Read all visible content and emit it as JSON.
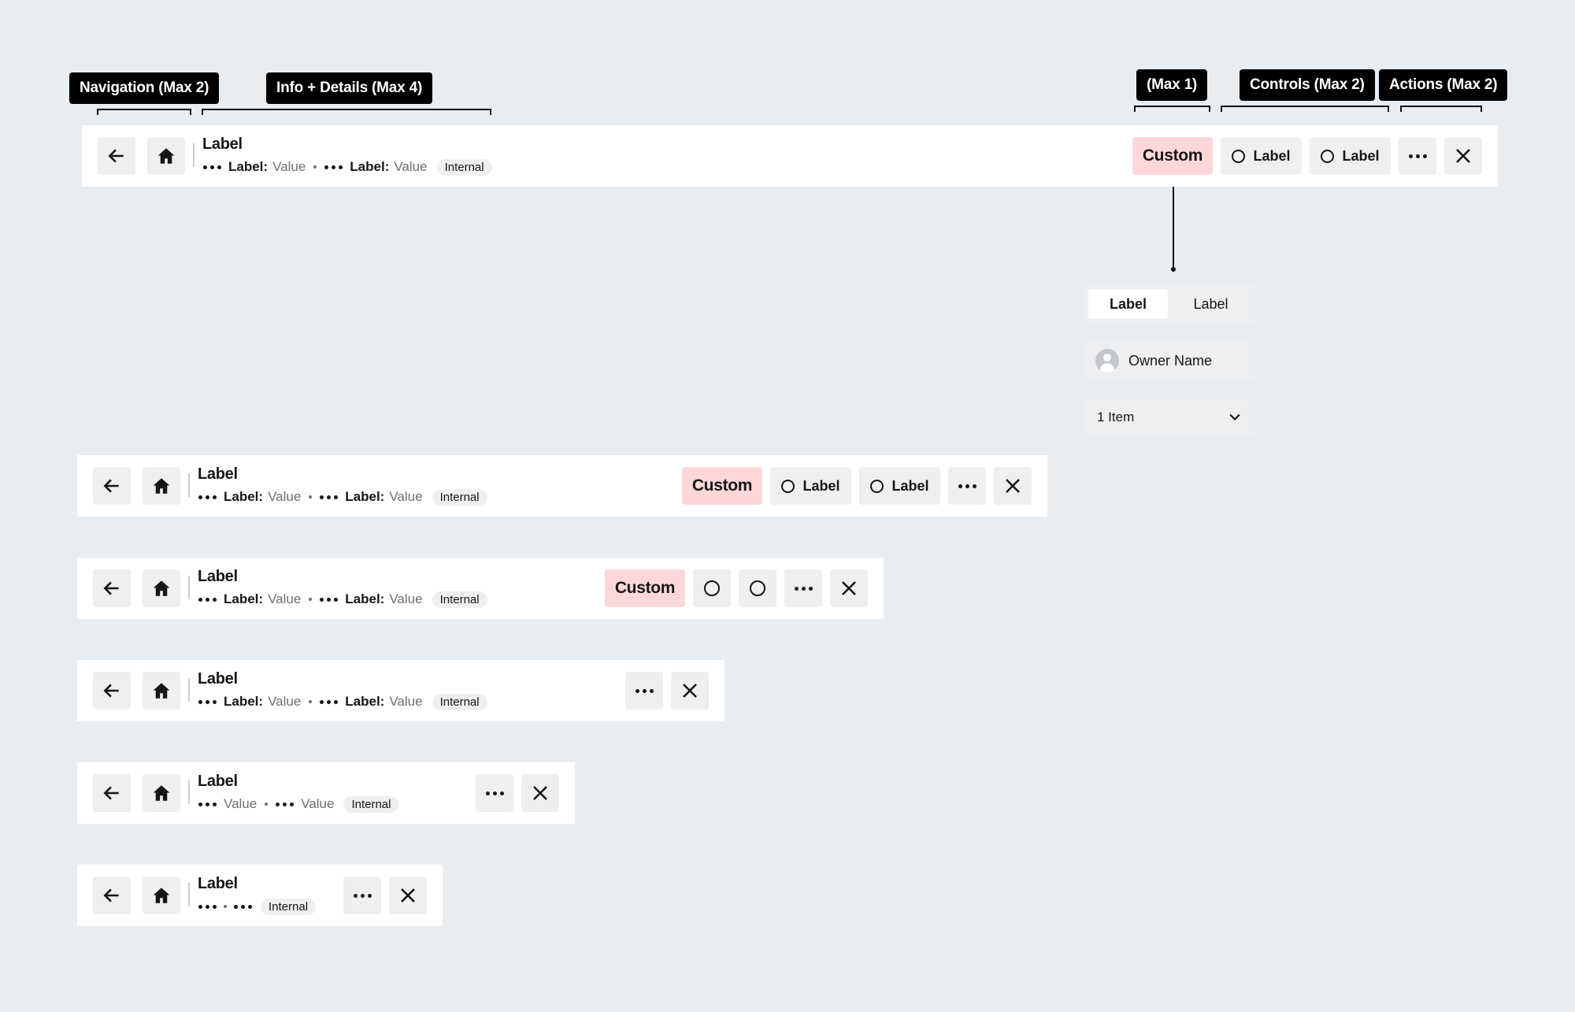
{
  "annotations": {
    "navigation": "Navigation (Max 2)",
    "info": "Info + Details (Max 4)",
    "custom": "(Max 1)",
    "controls": "Controls (Max 2)",
    "actions": "Actions (Max 2)"
  },
  "header": {
    "title": "Label",
    "meta_label": "Label:",
    "meta_value": "Value",
    "tag": "Internal",
    "custom_label": "Custom",
    "control_label": "Label"
  },
  "custom_examples": {
    "segmented": [
      "Label",
      "Label"
    ],
    "owner_name": "Owner Name",
    "dropdown_value": "1 Item"
  },
  "icons": {
    "back": "arrow-left-icon",
    "home": "home-icon",
    "overflow": "overflow-menu-icon",
    "close": "close-icon",
    "control": "radio-circle-icon",
    "avatar": "user-avatar-icon",
    "dropdown": "chevron-down-icon"
  },
  "colors": {
    "background": "#e8edf1",
    "bar": "#ffffff",
    "button": "#eeeff1",
    "custom_button": "#ffd7d9",
    "annotation": "#000000"
  }
}
